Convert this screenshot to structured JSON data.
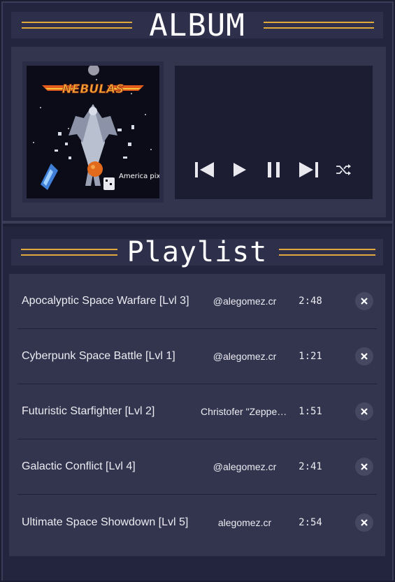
{
  "album": {
    "title": "ALBUM",
    "cover": {
      "game_title": "NEBULAS",
      "publisher": "America pixel games."
    }
  },
  "player": {
    "controls": [
      {
        "name": "previous-track-icon",
        "label": "Previous"
      },
      {
        "name": "play-icon",
        "label": "Play"
      },
      {
        "name": "pause-icon",
        "label": "Pause"
      },
      {
        "name": "next-track-icon",
        "label": "Next"
      },
      {
        "name": "shuffle-icon",
        "label": "Shuffle"
      }
    ]
  },
  "playlist": {
    "title": "Playlist",
    "tracks": [
      {
        "title": "Apocalyptic Space Warfare [Lvl 3]",
        "artist": "@alegomez.cr",
        "duration": "2:48"
      },
      {
        "title": "Cyberpunk Space Battle [Lvl 1]",
        "artist": "@alegomez.cr",
        "duration": "1:21"
      },
      {
        "title": "Futuristic Starfighter [Lvl 2]",
        "artist": "Christofer \"Zeppelin\"",
        "duration": "1:51"
      },
      {
        "title": "Galactic Conflict [Lvl 4]",
        "artist": "@alegomez.cr",
        "duration": "2:41"
      },
      {
        "title": "Ultimate Space Showdown [Lvl 5]",
        "artist": "alegomez.cr",
        "duration": "2:54"
      }
    ],
    "remove_icon": "close-icon"
  },
  "colors": {
    "accent": "#e0a93c",
    "background": "#1c1d33",
    "panel": "#33344e",
    "player": "#1c1d33"
  }
}
